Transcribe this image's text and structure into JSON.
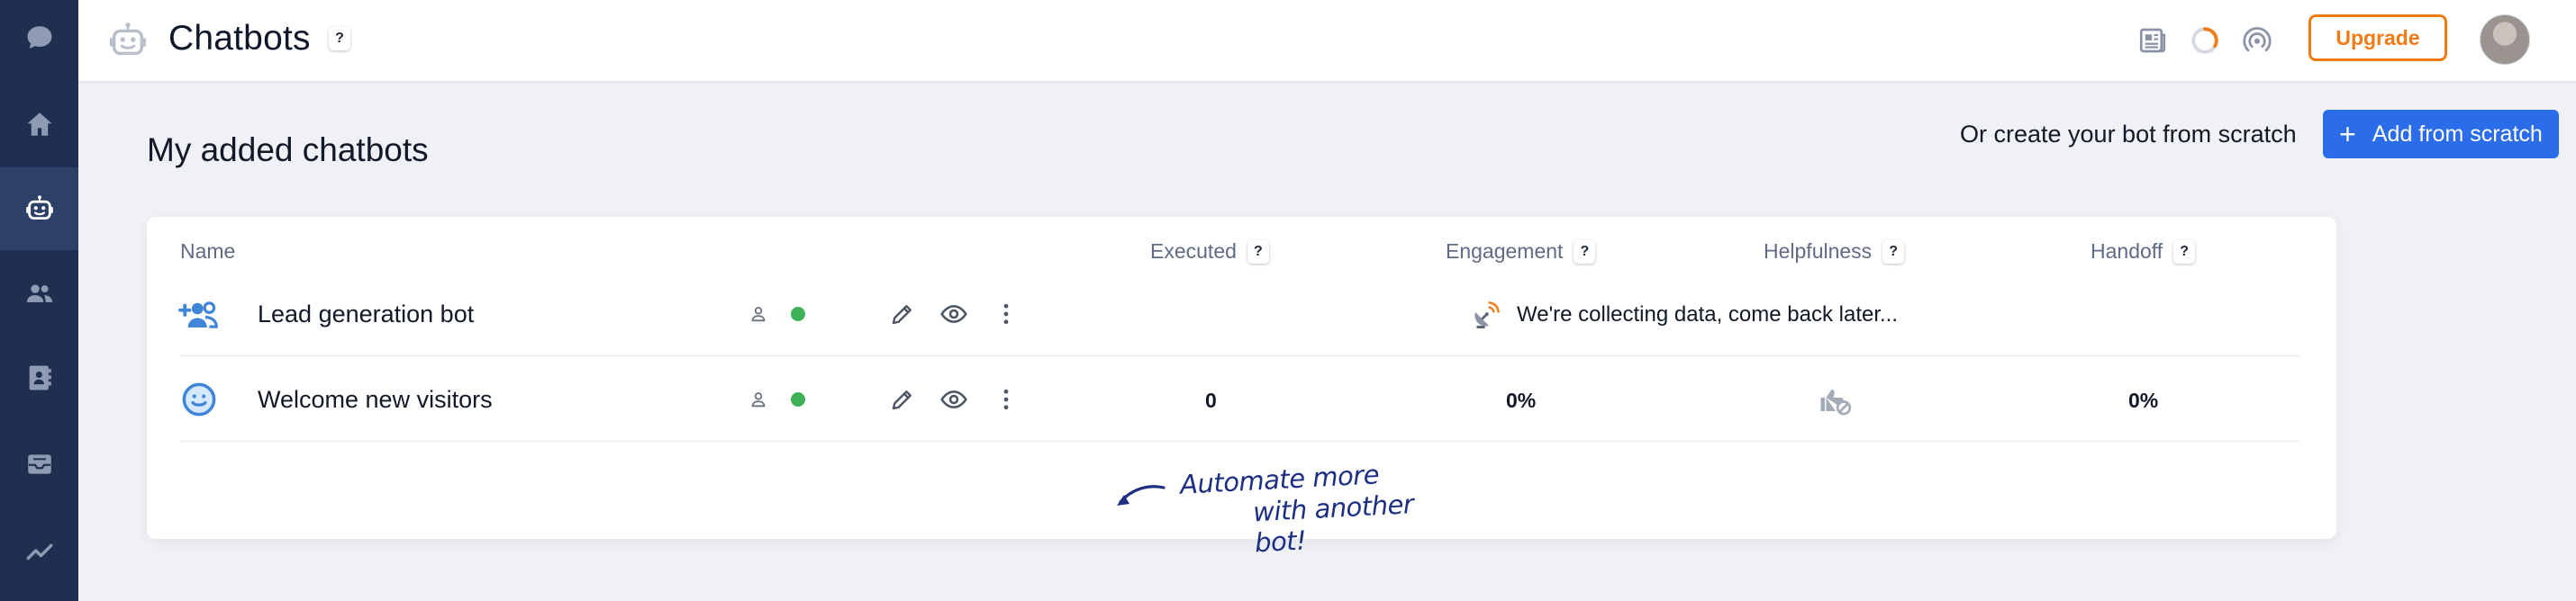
{
  "header": {
    "title": "Chatbots",
    "title_help": "?",
    "upgrade_label": "Upgrade",
    "icons": [
      "news-icon",
      "progress-ring-icon",
      "broadcast-icon"
    ]
  },
  "sidebar": {
    "items": [
      {
        "name": "conversations",
        "icon": "chat-bubble-icon"
      },
      {
        "name": "home",
        "icon": "home-icon"
      },
      {
        "name": "chatbots",
        "icon": "robot-icon",
        "active": true
      },
      {
        "name": "contacts",
        "icon": "people-icon"
      },
      {
        "name": "contact-book",
        "icon": "address-book-icon"
      },
      {
        "name": "inbox",
        "icon": "inbox-icon"
      },
      {
        "name": "analytics",
        "icon": "trend-icon"
      }
    ]
  },
  "main": {
    "section_title": "My added chatbots",
    "scratch_prompt": "Or create your bot from scratch",
    "add_button_label": "Add from scratch",
    "columns": {
      "name": "Name",
      "executed": "Executed",
      "engagement": "Engagement",
      "helpfulness": "Helpfulness",
      "handoff": "Handoff",
      "help": "?"
    },
    "bots": [
      {
        "name": "Lead generation bot",
        "icon": "add-people-icon",
        "status": "active",
        "collecting_message": "We're collecting data, come back later..."
      },
      {
        "name": "Welcome new visitors",
        "icon": "smiley-icon",
        "status": "active",
        "executed": "0",
        "engagement": "0%",
        "helpfulness_icon": "thumbs-up-disabled-icon",
        "handoff": "0%"
      }
    ],
    "automate_line1": "Automate more",
    "automate_line2": "with another bot!"
  },
  "colors": {
    "sidebar_bg": "#1e2f4f",
    "accent_blue": "#2b6de8",
    "upgrade_orange": "#f07b17",
    "status_green": "#3fb257",
    "handwriting_blue": "#1c2f82"
  }
}
